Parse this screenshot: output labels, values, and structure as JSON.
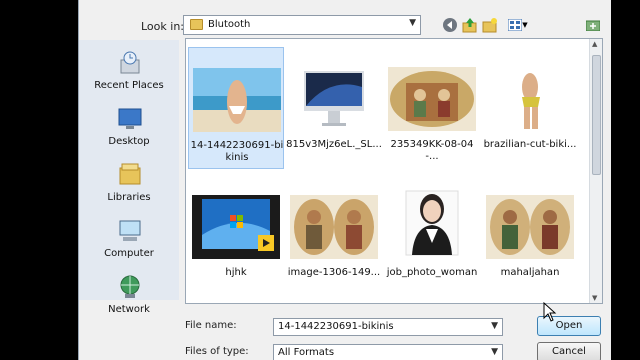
{
  "dialog": {
    "look_in_label": "Look in:",
    "look_in_value": "Blutooth"
  },
  "places": [
    {
      "label": "Recent Places",
      "icon": "recent-places-icon"
    },
    {
      "label": "Desktop",
      "icon": "desktop-icon"
    },
    {
      "label": "Libraries",
      "icon": "libraries-icon"
    },
    {
      "label": "Computer",
      "icon": "computer-icon"
    },
    {
      "label": "Network",
      "icon": "network-icon"
    }
  ],
  "files": [
    {
      "name": "14-1442230691-bikinis",
      "selected": true
    },
    {
      "name": "815v3Mjz6eL._SL..."
    },
    {
      "name": "235349KK-08-04-..."
    },
    {
      "name": "brazilian-cut-biki..."
    },
    {
      "name": "hjhk"
    },
    {
      "name": "image-1306-149..."
    },
    {
      "name": "job_photo_woman"
    },
    {
      "name": "mahaljahan"
    }
  ],
  "bottom": {
    "file_name_label": "File name:",
    "file_name_value": "14-1442230691-bikinis",
    "files_of_type_label": "Files of type:",
    "files_of_type_value": "All Formats",
    "open_label": "Open",
    "cancel_label": "Cancel"
  }
}
